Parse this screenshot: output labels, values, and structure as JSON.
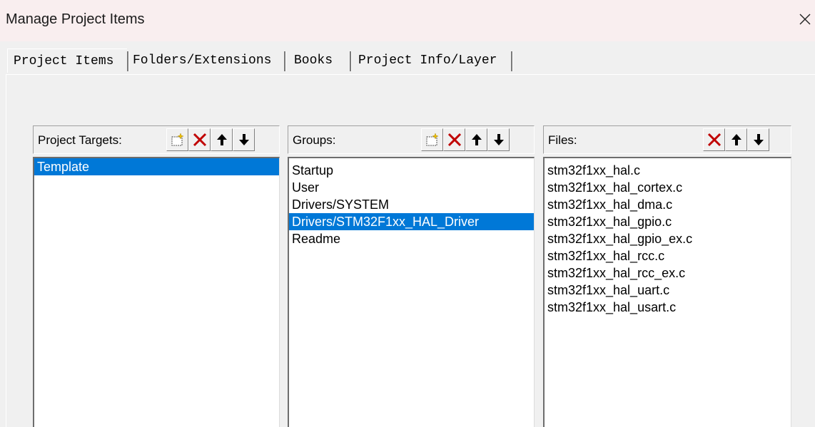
{
  "window": {
    "title": "Manage Project Items",
    "close_icon": "close-icon"
  },
  "tabs": [
    {
      "label": "Project Items",
      "active": true
    },
    {
      "label": "Folders/Extensions",
      "active": false
    },
    {
      "label": "Books",
      "active": false
    },
    {
      "label": "Project Info/Layer",
      "active": false
    }
  ],
  "targets": {
    "label": "Project Targets:",
    "toolbar": [
      "new-icon",
      "delete-icon",
      "move-up-icon",
      "move-down-icon"
    ],
    "items": [
      {
        "label": "Template",
        "selected": true
      }
    ]
  },
  "groups": {
    "label": "Groups:",
    "toolbar": [
      "new-icon",
      "delete-icon",
      "move-up-icon",
      "move-down-icon"
    ],
    "items": [
      {
        "label": "Startup",
        "selected": false
      },
      {
        "label": "User",
        "selected": false
      },
      {
        "label": "Drivers/SYSTEM",
        "selected": false
      },
      {
        "label": "Drivers/STM32F1xx_HAL_Driver",
        "selected": true
      },
      {
        "label": "Readme",
        "selected": false
      }
    ]
  },
  "files": {
    "label": "Files:",
    "toolbar": [
      "delete-icon",
      "move-up-icon",
      "move-down-icon"
    ],
    "items": [
      {
        "label": "stm32f1xx_hal.c",
        "selected": false
      },
      {
        "label": "stm32f1xx_hal_cortex.c",
        "selected": false
      },
      {
        "label": "stm32f1xx_hal_dma.c",
        "selected": false
      },
      {
        "label": "stm32f1xx_hal_gpio.c",
        "selected": false
      },
      {
        "label": "stm32f1xx_hal_gpio_ex.c",
        "selected": false
      },
      {
        "label": "stm32f1xx_hal_rcc.c",
        "selected": false
      },
      {
        "label": "stm32f1xx_hal_rcc_ex.c",
        "selected": false
      },
      {
        "label": "stm32f1xx_hal_uart.c",
        "selected": false
      },
      {
        "label": "stm32f1xx_hal_usart.c",
        "selected": false
      }
    ]
  },
  "colors": {
    "selection": "#0078d7",
    "delete_icon": "#c00000",
    "titlebar": "#f9eeef"
  }
}
